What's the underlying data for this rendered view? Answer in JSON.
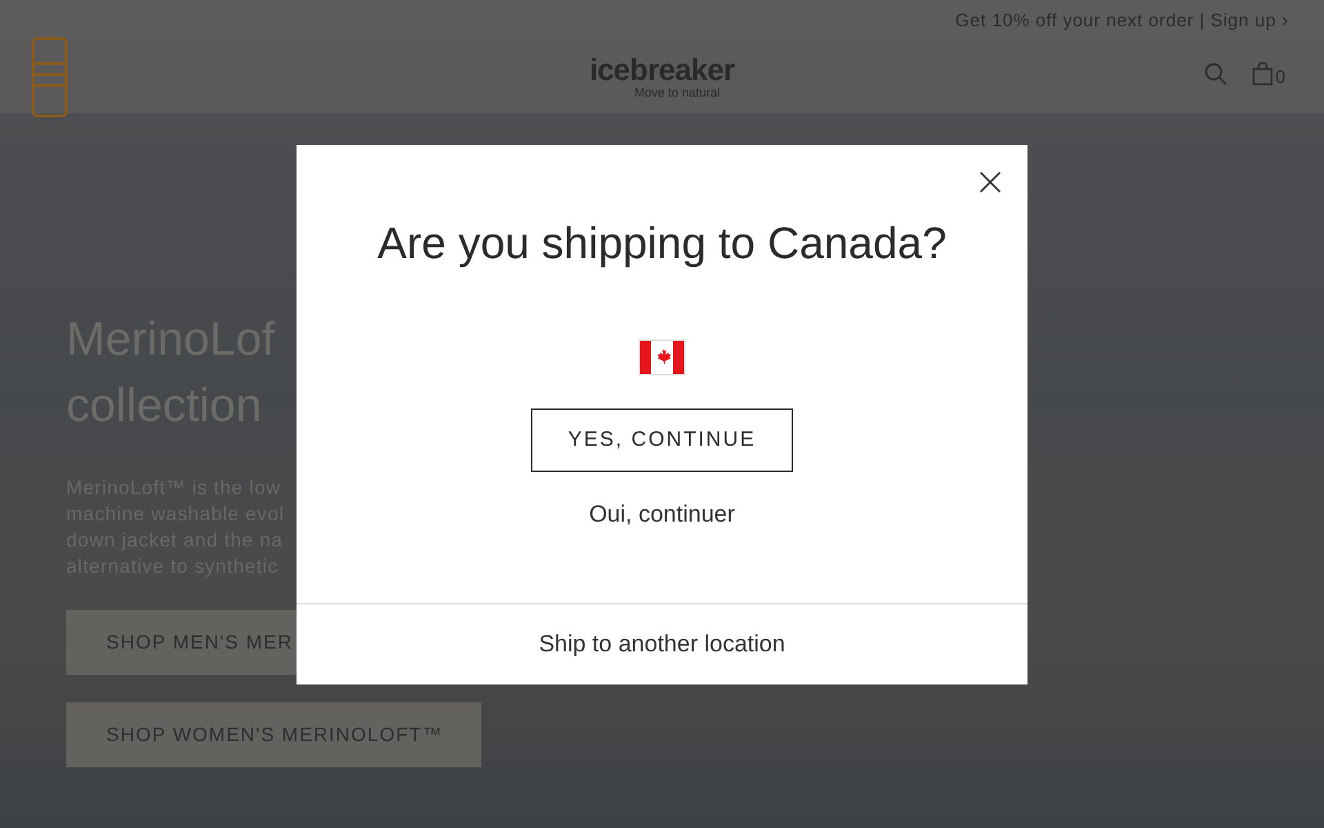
{
  "promo_bar": {
    "text": "Get 10% off your next order | Sign up",
    "chevron": "›"
  },
  "header": {
    "logo": "icebreaker",
    "tagline": "Move to natural",
    "cart_count": "0"
  },
  "hero": {
    "heading_lines": [
      "MerinoLof",
      "collection"
    ],
    "body_lines": [
      "MerinoLoft™ is the low",
      "machine washable evol",
      "down jacket and the na",
      "alternative to synthetic"
    ],
    "buttons": [
      "SHOP MEN'S MER",
      "SHOP WOMEN'S MERINOLOFT™"
    ]
  },
  "modal": {
    "title": "Are you shipping to Canada?",
    "primary_button": "YES, CONTINUE",
    "secondary_link": "Oui, continuer",
    "footer_link": "Ship to another location"
  }
}
